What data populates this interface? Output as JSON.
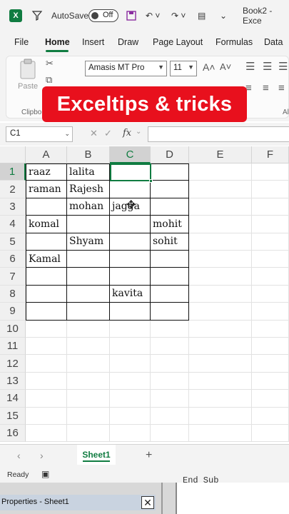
{
  "titlebar": {
    "autosave_label": "AutoSave",
    "autosave_state": "Off",
    "doc_title": "Book2 - Exce"
  },
  "ribbon_tabs": [
    "File",
    "Home",
    "Insert",
    "Draw",
    "Page Layout",
    "Formulas",
    "Data"
  ],
  "ribbon": {
    "paste_label": "Paste",
    "clipboard_label": "Clipbo",
    "font_name": "Amasis MT Pro",
    "font_size": "11",
    "grow_font": "A˄",
    "shrink_font": "A˅",
    "alignment_label": "Al"
  },
  "banner": {
    "text": "Exceltips & tricks",
    "color": "#e8101d"
  },
  "formula_bar": {
    "name_box": "C1",
    "fx": "fx",
    "formula": ""
  },
  "grid": {
    "columns": [
      "A",
      "B",
      "C",
      "D",
      "E",
      "F"
    ],
    "rows": [
      "1",
      "2",
      "3",
      "4",
      "5",
      "6",
      "7",
      "8",
      "9",
      "10",
      "11",
      "12",
      "13",
      "14",
      "15",
      "16"
    ],
    "selected_cell": "C1",
    "cells": {
      "A1": "raaz",
      "B1": "lalita",
      "A2": "raman",
      "B2": "Rajesh",
      "B3": "mohan",
      "C3": "jagga",
      "A4": "komal",
      "D4": "mohit",
      "B5": "Shyam",
      "D5": "sohit",
      "A6": "Kamal",
      "C8": "kavita"
    }
  },
  "sheets": {
    "active": "Sheet1",
    "add": "+"
  },
  "status": {
    "text": "Ready"
  },
  "vba": {
    "properties_title": "Properties - Sheet1",
    "code_snippet": "End Sub"
  },
  "colors": {
    "accent": "#107c41",
    "banner": "#e8101d"
  }
}
